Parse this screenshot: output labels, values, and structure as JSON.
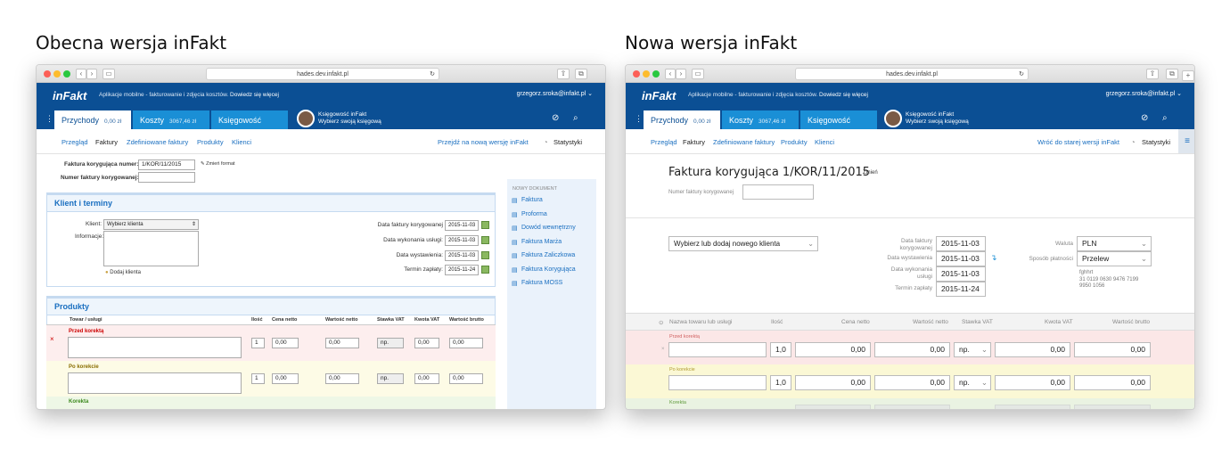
{
  "left_heading": "Obecna wersja inFakt",
  "right_heading": "Nowa wersja inFakt",
  "browser": {
    "url": "hades.dev.infakt.pl",
    "plus": "+"
  },
  "app": {
    "logo": "inFakt",
    "promo_text": "Aplikacje mobilne - fakturowanie i zdjęcia kosztów.",
    "promo_link": "Dowiedz się więcej",
    "email": "grzegorz.sroka@infakt.pl",
    "tabs": [
      {
        "label": "Przychody",
        "amount": "0,00 zł"
      },
      {
        "label": "Koszty",
        "amount": "3067,46 zł"
      },
      {
        "label": "Księgowość",
        "amount": ""
      }
    ],
    "account_name": "Księgowość inFakt",
    "account_sub": "Wybierz swoją księgową",
    "subnav": [
      "Przegląd",
      "Faktury",
      "Zdefiniowane faktury",
      "Produkty",
      "Klienci"
    ],
    "stats": "Statystyki"
  },
  "old": {
    "switch_link": "Przejdź na nową wersję inFakt",
    "invoice_number_label": "Faktura korygująca numer:",
    "invoice_number": "1/KOR/11/2015",
    "change_format": "Zmień format",
    "corrected_label": "Numer faktury korygowanej:",
    "client_section": "Klient i terminy",
    "client_label": "Klient:",
    "client_select": "Wybierz klienta",
    "info_label": "Informacje:",
    "add_client": "Dodaj klienta",
    "dates": [
      {
        "label": "Data faktury korygowanej",
        "value": "2015-11-03"
      },
      {
        "label": "Data wykonania usługi:",
        "value": "2015-11-03"
      },
      {
        "label": "Data wystawienia:",
        "value": "2015-11-03"
      },
      {
        "label": "Termin zapłaty:",
        "value": "2015-11-24"
      }
    ],
    "products_section": "Produkty",
    "columns": [
      "Towar / usługi",
      "Ilość",
      "Cena netto",
      "Wartość netto",
      "Stawka VAT",
      "Kwota VAT",
      "Wartość brutto"
    ],
    "before": "Przed korektą",
    "after": "Po korekcie",
    "correction": "Korekta",
    "qty": "1",
    "zero": "0,00",
    "vat": "np.",
    "remove": "×",
    "sidebar_title": "NOWY DOKUMENT",
    "sidebar_items": [
      "Faktura",
      "Proforma",
      "Dowód wewnętrzny",
      "Faktura Marża",
      "Faktura Zaliczkowa",
      "Faktura Korygująca",
      "Faktura MOSS"
    ]
  },
  "new": {
    "back_link": "Wróć do starej wersji inFakt",
    "title": "Faktura korygująca 1/KOR/11/2015",
    "change": "Zmień",
    "corrected_label": "Numer faktury korygowanej",
    "client_select": "Wybierz lub dodaj nowego klienta",
    "dates": [
      {
        "label": "Data faktury korygowanej",
        "value": "2015-11-03"
      },
      {
        "label": "Data wystawienia",
        "value": "2015-11-03"
      },
      {
        "label": "Data wykonania usługi",
        "value": "2015-11-03"
      },
      {
        "label": "Termin zapłaty",
        "value": "2015-11-24"
      }
    ],
    "currency_label": "Waluta",
    "currency": "PLN",
    "payment_label": "Sposób płatności",
    "payment": "Przelew",
    "bank_line1": "fghhrt",
    "bank_line2": "31 0119 0630 9476 7199",
    "bank_line3": "9950 1056",
    "columns": [
      "Nazwa towaru lub usługi",
      "Ilość",
      "Cena netto",
      "Wartość netto",
      "Stawka VAT",
      "Kwota VAT",
      "Wartość brutto"
    ],
    "before": "Przed korektą",
    "after": "Po korekcie",
    "correction": "Korekta",
    "qty": "1,0",
    "zero": "0,00",
    "vat": "np."
  }
}
